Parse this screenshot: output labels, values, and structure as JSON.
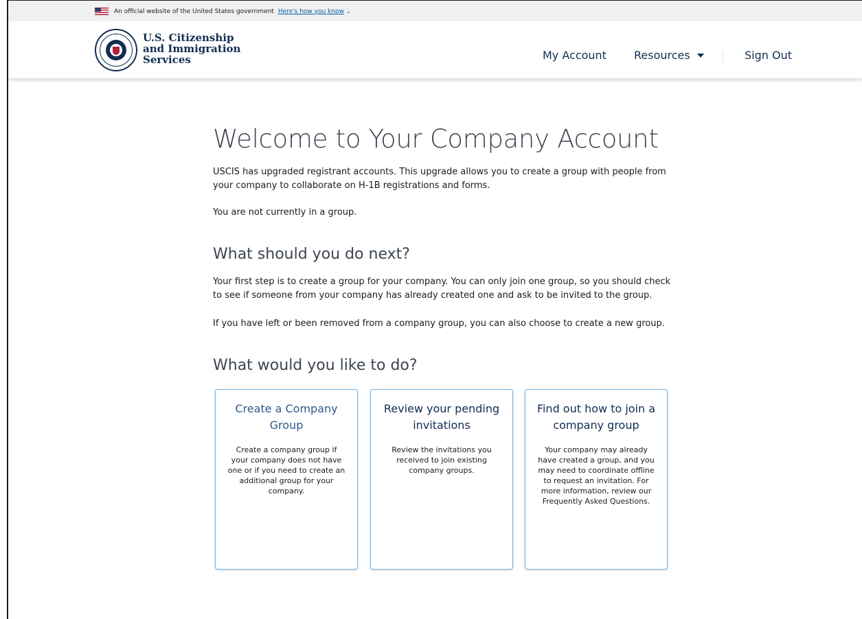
{
  "gov_banner": {
    "official_text": "An official website of the United States government",
    "how_text": "Here's how you know",
    "chevron": "⌄"
  },
  "header": {
    "logo_lines": [
      "U.S. Citizenship",
      "and Immigration",
      "Services"
    ],
    "nav": {
      "my_account": "My Account",
      "resources": "Resources",
      "sign_out": "Sign Out"
    }
  },
  "main": {
    "title": "Welcome to Your Company Account",
    "intro": "USCIS has upgraded registrant accounts. This upgrade allows you to create a group  with people from your company to collaborate on H-1B registrations and forms.",
    "not_in_group": "You are not currently in a group.",
    "next_heading": "What should you do next?",
    "first_step": "Your first step is to create a group for your company. You can only join one group, so you should check to see if someone from your company has already created one and ask to be invited to the group.",
    "left_removed": "If you have left or been removed from a company group, you can also choose to create a new group.",
    "like_heading": "What would you like to do?",
    "cards": [
      {
        "title": "Create a Company Group",
        "description": "Create a company group if your company does not have one or if you need to create an additional group for your company."
      },
      {
        "title": "Review your pending invitations",
        "description": "Review the invitations you received to join existing company groups."
      },
      {
        "title": "Find out how to join a company group",
        "description": "Your company may already have created a group, and you may need to coordinate offline to request an invitation. For more information, review our Frequently Asked Questions."
      }
    ]
  },
  "colors": {
    "brand_navy": "#112e51",
    "link_blue": "#005ea2",
    "card_border": "#73b3e7"
  }
}
